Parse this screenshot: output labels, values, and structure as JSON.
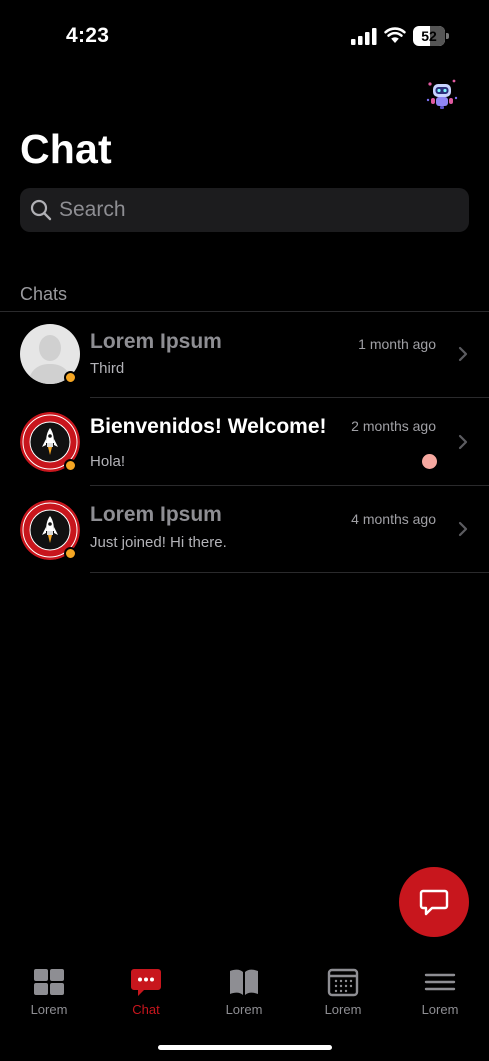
{
  "status_bar": {
    "time": "4:23",
    "battery_level": "52"
  },
  "header": {
    "title": "Chat"
  },
  "search": {
    "placeholder": "Search"
  },
  "section": {
    "title": "Chats"
  },
  "chats": [
    {
      "name": "Lorem Ipsum",
      "preview": "Third",
      "time": "1 month ago",
      "unread": false,
      "avatar": "placeholder-person"
    },
    {
      "name": "Bienvenidos! Welcome!",
      "preview": "Hola!",
      "time": "2 months ago",
      "unread": true,
      "avatar": "rocket-seal"
    },
    {
      "name": "Lorem Ipsum",
      "preview": "Just joined! Hi there.",
      "time": "4 months ago",
      "unread": false,
      "avatar": "rocket-seal"
    }
  ],
  "tabs": [
    {
      "label": "Lorem",
      "icon": "grid-icon",
      "active": false
    },
    {
      "label": "Chat",
      "icon": "chat-bubble-icon",
      "active": true
    },
    {
      "label": "Lorem",
      "icon": "book-icon",
      "active": false
    },
    {
      "label": "Lorem",
      "icon": "calendar-icon",
      "active": false
    },
    {
      "label": "Lorem",
      "icon": "menu-icon",
      "active": false
    }
  ],
  "colors": {
    "accent": "#c8161d",
    "presence": "#f5a623",
    "unread_dot": "#f6a8a0",
    "background": "#000000"
  }
}
